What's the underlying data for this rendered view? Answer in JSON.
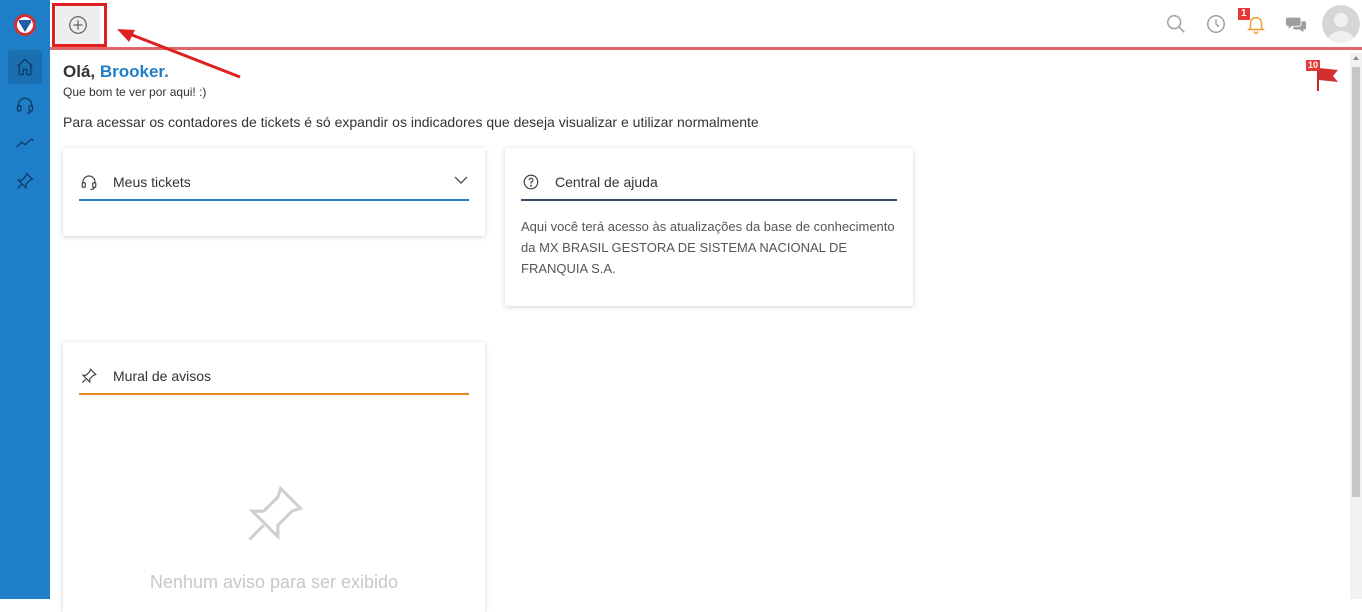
{
  "header": {
    "notification_count": "1"
  },
  "greeting": {
    "hello": "Olá,",
    "name": "Brooker.",
    "subtitle": "Que bom te ver por aqui! :)",
    "info": "Para acessar os contadores de tickets é só expandir os indicadores que deseja visualizar e utilizar normalmente"
  },
  "flag": {
    "count": "10"
  },
  "cards": {
    "tickets": {
      "title": "Meus tickets"
    },
    "help": {
      "title": "Central de ajuda",
      "body": "Aqui você terá acesso às atualizações da base de conhecimento da MX BRASIL GESTORA DE SISTEMA NACIONAL DE FRANQUIA S.A."
    },
    "notices": {
      "title": "Mural de avisos",
      "empty": "Nenhum aviso para ser exibido"
    }
  },
  "colors": {
    "sidebar": "#1e7ec8",
    "accent_red": "#e53935",
    "tickets_line": "#1e7ec8",
    "help_line": "#3a4a6a",
    "notices_line": "#e08a1e"
  },
  "icons": {
    "sidebar": [
      "home-icon",
      "headset-icon",
      "trend-icon",
      "pin-icon"
    ],
    "topbar": [
      "search-icon",
      "clock-icon",
      "bell-icon",
      "chat-icon"
    ]
  }
}
